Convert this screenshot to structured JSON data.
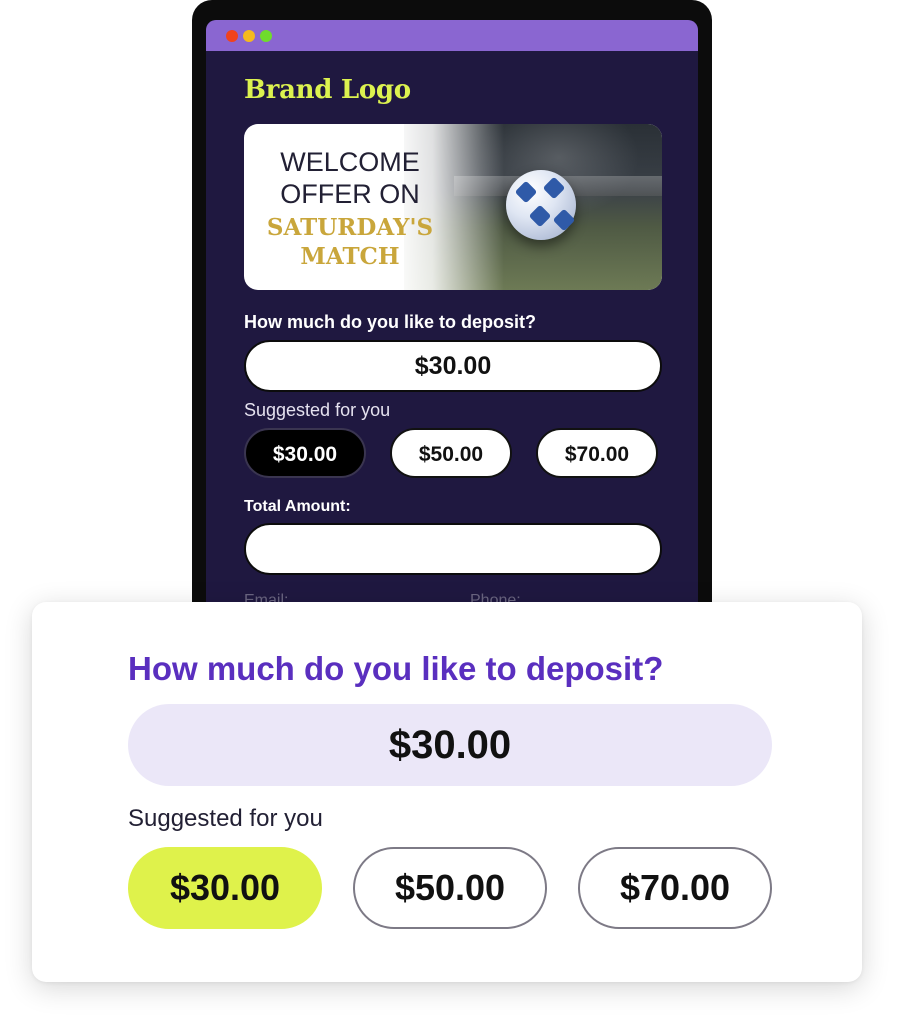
{
  "window": {
    "traffic_lights": [
      "#f0421d",
      "#f5b91e",
      "#6fdc2c"
    ],
    "titlebar_color": "#8a66d1"
  },
  "brand": {
    "logo_text": "Brand Logo",
    "color": "#dcf24f"
  },
  "banner": {
    "line1": "WELCOME",
    "line2": "OFFER ON",
    "line3": "SATURDAY'S",
    "line4": "MATCH",
    "image": "soccer-ball-photo"
  },
  "form": {
    "deposit_question": "How much do you like to deposit?",
    "deposit_value": "$30.00",
    "suggested_label": "Suggested for you",
    "suggestions": [
      "$30.00",
      "$50.00",
      "$70.00"
    ],
    "selected_index": 0,
    "total_label": "Total Amount:",
    "total_value": "",
    "email_label": "Email:",
    "phone_label": "Phone:"
  },
  "zoom_card": {
    "deposit_question": "How much do you like to deposit?",
    "deposit_value": "$30.00",
    "suggested_label": "Suggested for you",
    "suggestions": [
      "$30.00",
      "$50.00",
      "$70.00"
    ],
    "selected_index": 0,
    "accent_color": "#5a2fbf",
    "selected_color": "#dff24b"
  }
}
